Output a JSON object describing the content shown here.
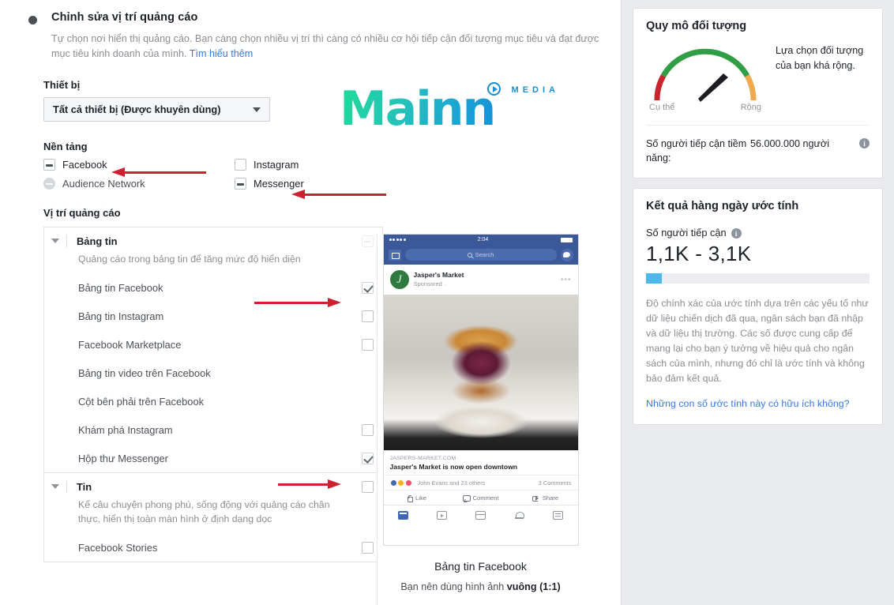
{
  "main": {
    "section_title": "Chỉnh sửa vị trí quảng cáo",
    "section_desc": "Tự chọn nơi hiển thị quảng cáo. Bạn càng chọn nhiều vị trí thì càng có nhiều cơ hội tiếp cận đối tượng mục tiêu và đạt được mục tiêu kinh doanh của mình. ",
    "learn_more": "Tìm hiểu thêm",
    "device_label": "Thiết bị",
    "device_value": "Tất cả thiết bị (Được khuyên dùng)",
    "platform_label": "Nền tảng",
    "platforms": [
      {
        "label": "Facebook",
        "state": "indeterminate"
      },
      {
        "label": "Instagram",
        "state": "unchecked"
      },
      {
        "label": "Audience Network",
        "state": "disabled-dash"
      },
      {
        "label": "Messenger",
        "state": "indeterminate"
      }
    ],
    "placements_label": "Vị trí quảng cáo",
    "groups": [
      {
        "title": "Bảng tin",
        "desc": "Quảng cáo trong bảng tin để tăng mức độ hiển diện",
        "group_state": "faint-indeterminate",
        "rows": [
          {
            "label": "Bảng tin Facebook",
            "state": "checked"
          },
          {
            "label": "Bảng tin Instagram",
            "state": "unchecked"
          },
          {
            "label": "Facebook Marketplace",
            "state": "unchecked"
          },
          {
            "label": "Bảng tin video trên Facebook",
            "state": "none"
          },
          {
            "label": "Cột bên phải trên Facebook",
            "state": "none"
          },
          {
            "label": "Khám phá Instagram",
            "state": "unchecked"
          },
          {
            "label": "Hộp thư Messenger",
            "state": "checked"
          }
        ]
      },
      {
        "title": "Tin",
        "desc": "Kể câu chuyện phong phú, sống động với quảng cáo chân thực, hiển thị toàn màn hình ở định dạng dọc",
        "group_state": "unchecked",
        "rows": [
          {
            "label": "Facebook Stories",
            "state": "unchecked"
          }
        ]
      }
    ]
  },
  "logo": {
    "word": "Mainn",
    "media": "MEDIA"
  },
  "preview": {
    "status_time": "2:04",
    "search_placeholder": "Search",
    "page_name": "Jasper's Market",
    "sponsored": "Sponsored · ",
    "link_domain": "JASPERS-MARKET.COM",
    "link_title": "Jasper's Market is now open downtown",
    "reaction_names": "John Evans and 23 others",
    "comments": "3 Comments",
    "action_like": "Like",
    "action_comment": "Comment",
    "action_share": "Share",
    "caption": "Bảng tin Facebook",
    "sub_prefix": "Bạn nên dùng hình ảnh ",
    "sub_bold": "vuông (1:1)"
  },
  "sidebar": {
    "audience_card": {
      "title": "Quy mô đối tượng",
      "gauge_left": "Cụ thể",
      "gauge_right": "Rộng",
      "note": "Lựa chọn đối tượng của bạn khá rộng.",
      "reach_label": "Số người tiếp cận tiềm năng:",
      "reach_value": "56.000.000 người"
    },
    "results_card": {
      "title": "Kết quả hàng ngày ước tính",
      "metric_label": "Số người tiếp cận",
      "metric_value": "1,1K - 3,1K",
      "meter_percent": 7,
      "disclaimer": "Độ chính xác của ước tính dựa trên các yếu tố như dữ liệu chiến dịch đã qua, ngân sách bạn đã nhập và dữ liệu thị trường. Các số được cung cấp để mang lại cho bạn ý tưởng về hiệu quả cho ngân sách của mình, nhưng đó chỉ là ước tính và không bảo đảm kết quả.",
      "feedback_link": "Những con số ước tính này có hữu ích không?"
    }
  },
  "colors": {
    "arrow_red": "#cf2030",
    "fb_blue": "#3b5998",
    "link_blue": "#3578e5",
    "meter_blue": "#4cb8e8",
    "gauge_green": "#2f9e44",
    "gauge_red": "#c9252d",
    "gauge_orange": "#f0a94c"
  }
}
